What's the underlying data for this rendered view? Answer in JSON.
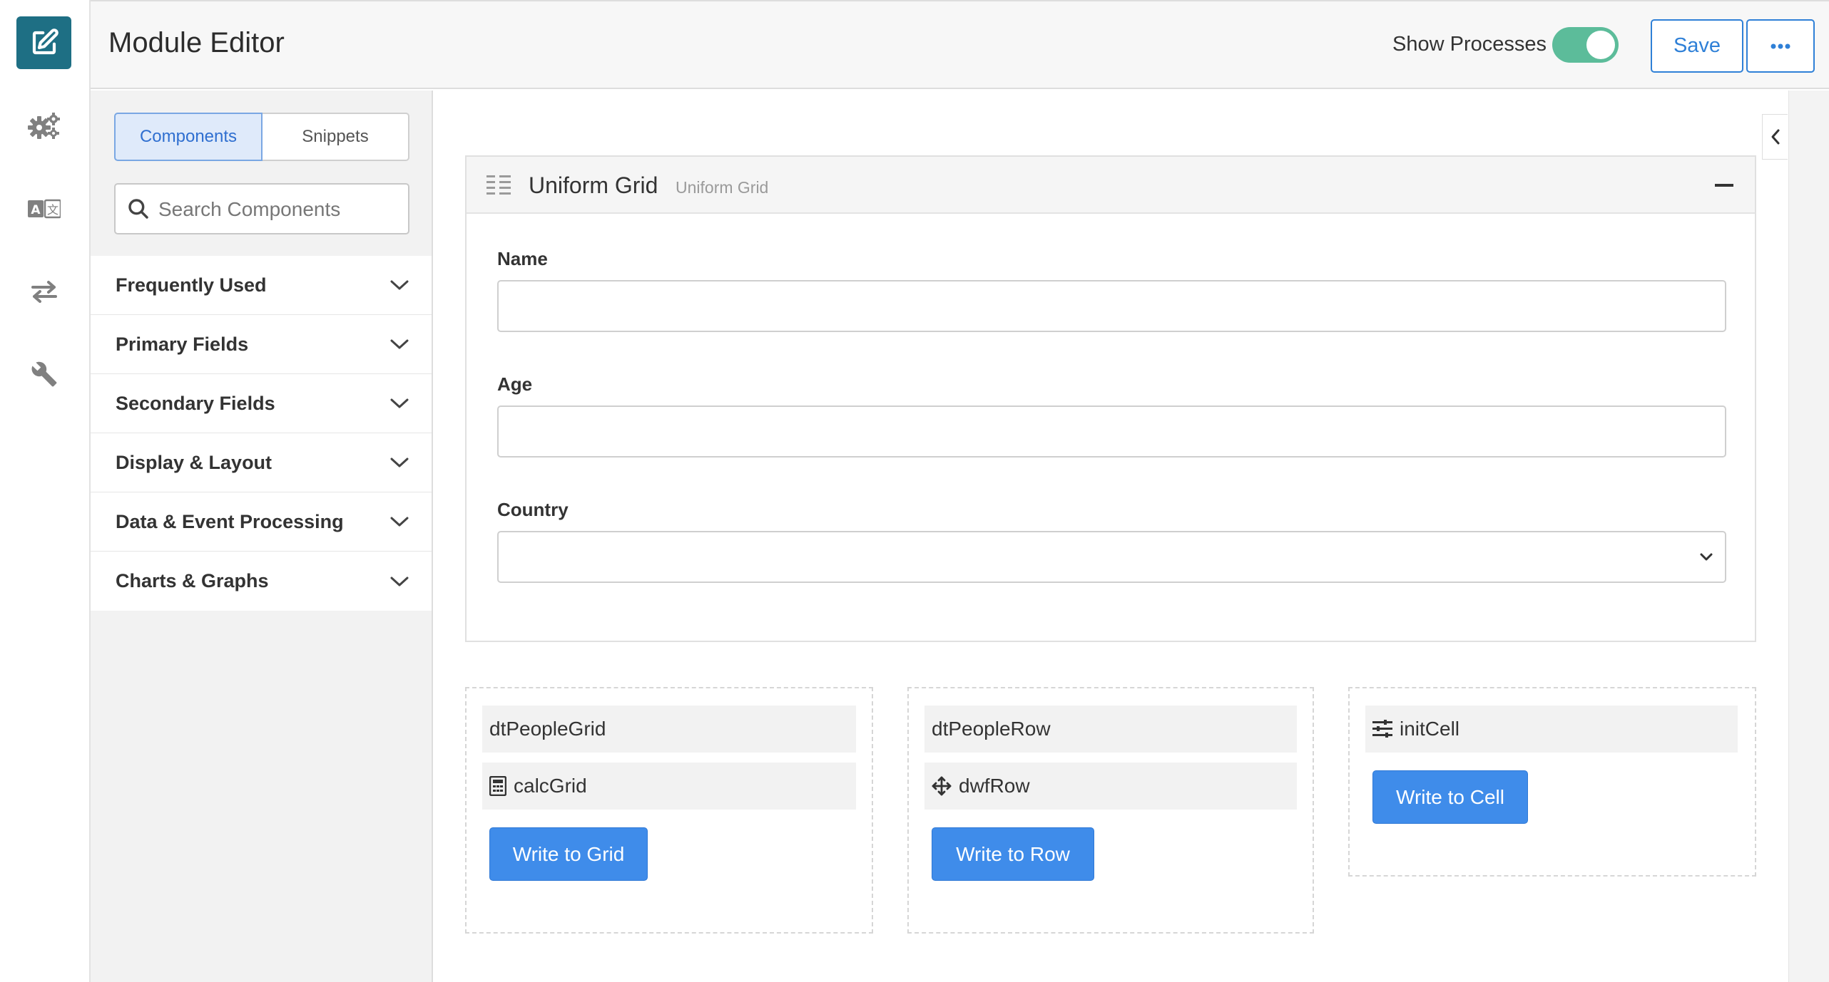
{
  "header": {
    "title": "Module Editor",
    "show_processes_label": "Show Processes",
    "show_processes_on": true,
    "save_label": "Save",
    "more_icon": "ellipsis-icon"
  },
  "rail": {
    "items": [
      "edit-icon",
      "settings-gears-icon",
      "translate-icon",
      "transfer-arrows-icon",
      "wrench-icon"
    ]
  },
  "panel": {
    "tabs": [
      "Components",
      "Snippets"
    ],
    "active_tab": "Components",
    "search_placeholder": "Search Components",
    "categories": [
      "Frequently Used",
      "Primary Fields",
      "Secondary Fields",
      "Display & Layout",
      "Data & Event Processing",
      "Charts & Graphs"
    ]
  },
  "grid": {
    "title": "Uniform Grid",
    "subtitle": "Uniform Grid",
    "fields": [
      {
        "label": "Name",
        "value": ""
      },
      {
        "label": "Age",
        "value": ""
      },
      {
        "label": "Country",
        "value": ""
      }
    ]
  },
  "processes": [
    {
      "rows": [
        {
          "label": "dtPeopleGrid",
          "icon": ""
        },
        {
          "label": "calcGrid",
          "icon": "calculator-icon"
        }
      ],
      "button": "Write to Grid"
    },
    {
      "rows": [
        {
          "label": "dtPeopleRow",
          "icon": ""
        },
        {
          "label": "dwfRow",
          "icon": "move-arrows-icon"
        }
      ],
      "button": "Write to Row"
    },
    {
      "rows": [
        {
          "label": "initCell",
          "icon": "sliders-icon"
        }
      ],
      "button": "Write to Cell"
    }
  ],
  "colors": {
    "accent": "#3f8cea",
    "brand": "#1e6f84",
    "toggle_on": "#5cbc9a"
  }
}
